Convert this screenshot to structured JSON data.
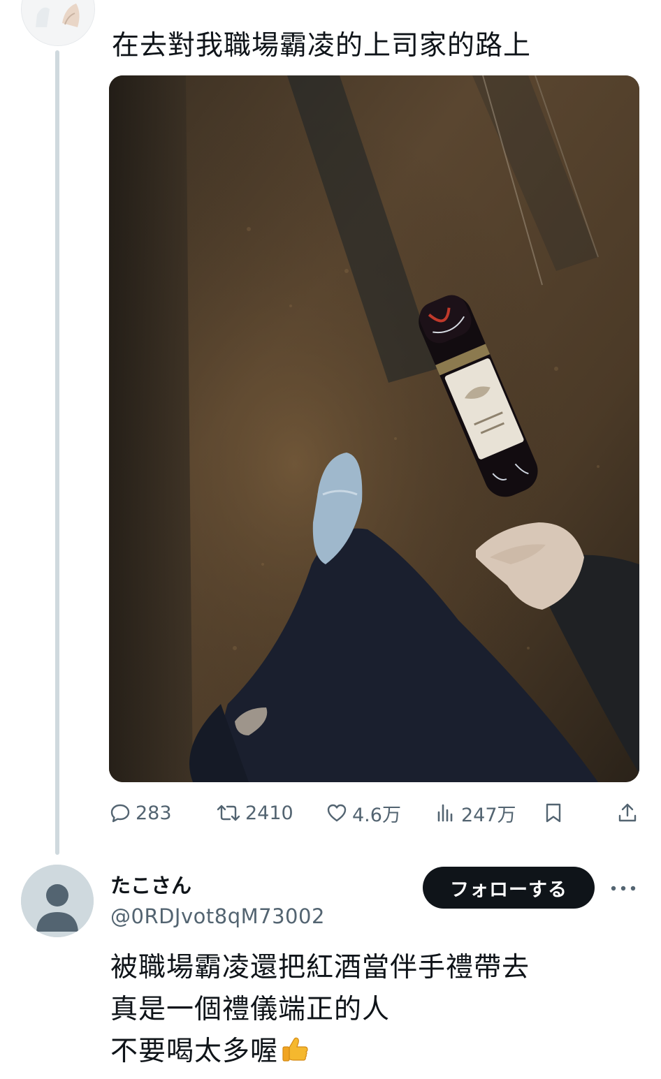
{
  "tweet": {
    "text": "在去對我職場霸凌的上司家的路上",
    "media": {
      "alt_icon": "photo-wine-bottle-walk"
    },
    "actions": {
      "replies": "283",
      "retweets": "2410",
      "likes": "4.6万",
      "views": "247万"
    }
  },
  "reply": {
    "name": "たこさん",
    "handle": "@0RDJvot8qM73002",
    "follow_label": "フォローする",
    "lines": [
      "被職場霸凌還把紅酒當伴手禮帶去",
      "真是一個禮儀端正的人",
      "不要喝太多喔"
    ],
    "emoji": "thumbs-up-icon"
  },
  "colors": {
    "text": "#0f1419",
    "secondary": "#536471",
    "thread_line": "#cfd9de",
    "follow_bg": "#0f1419"
  }
}
